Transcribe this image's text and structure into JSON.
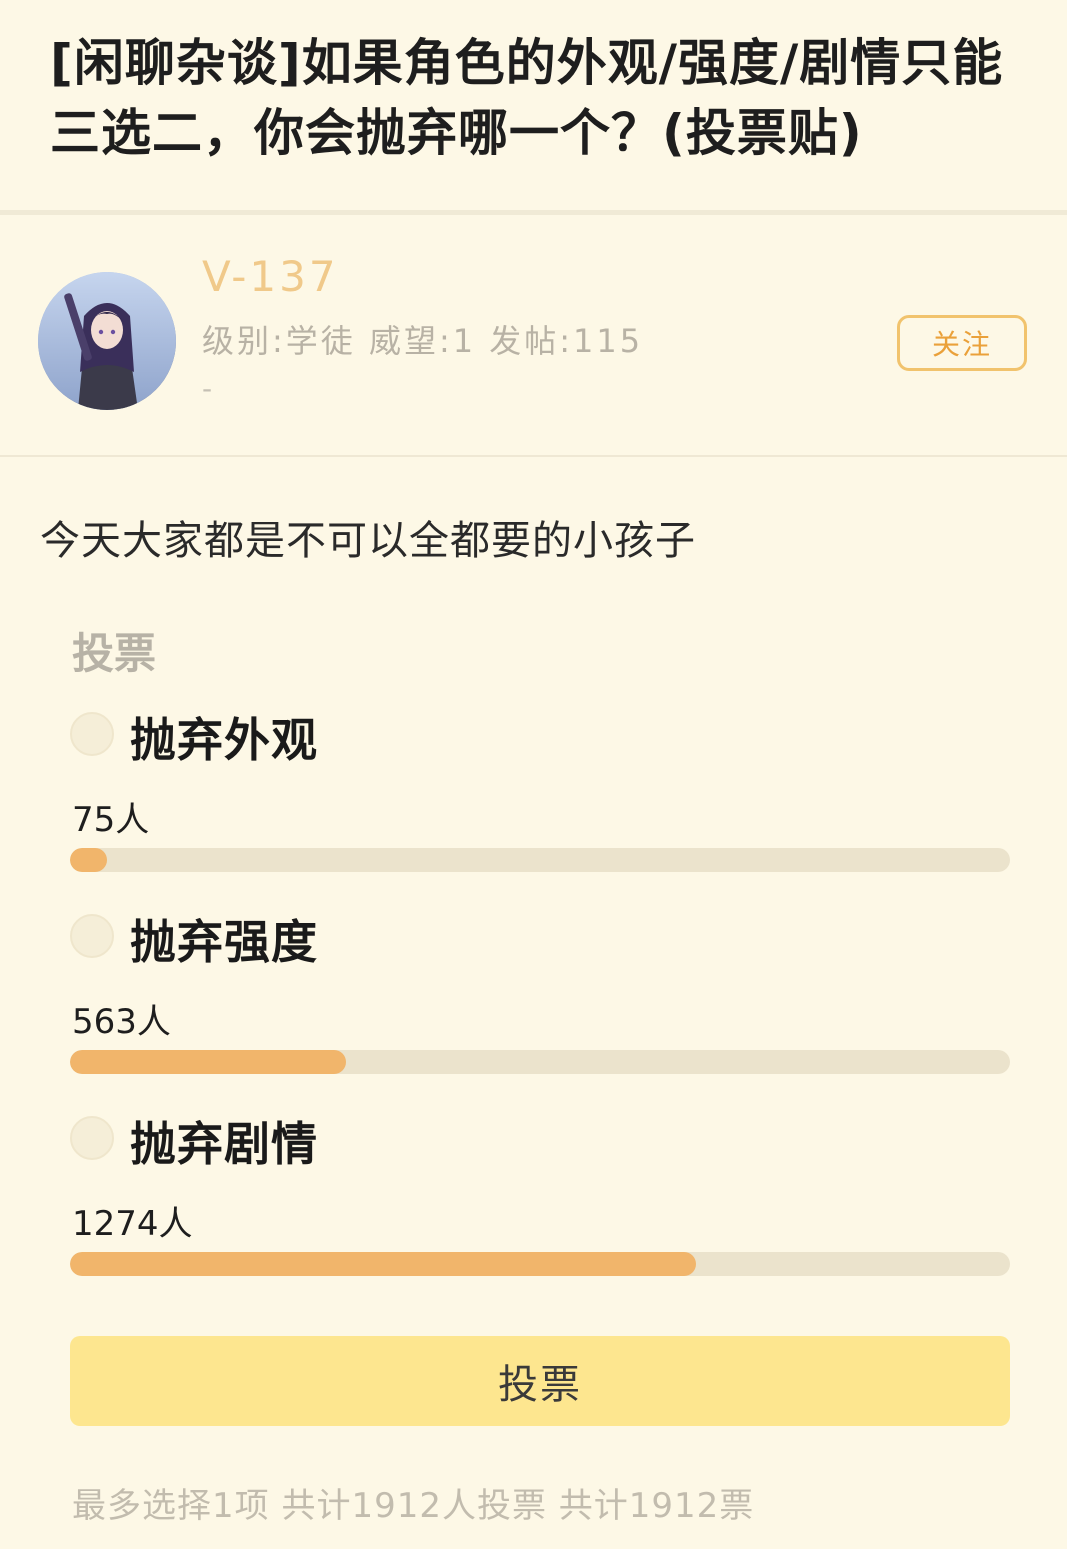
{
  "post": {
    "title": "[闲聊杂谈]如果角色的外观/强度/剧情只能三选二，你会抛弃哪一个？(投票贴)",
    "content": "今天大家都是不可以全都要的小孩子"
  },
  "author": {
    "name": "V-137",
    "stats": "级别:学徒  威望:1  发帖:115",
    "signature": "-",
    "follow_label": "关注"
  },
  "poll": {
    "title": "投票",
    "options": [
      {
        "label": "抛弃外观",
        "count_text": "75人",
        "votes": 75,
        "fraction": 0.039
      },
      {
        "label": "抛弃强度",
        "count_text": "563人",
        "votes": 563,
        "fraction": 0.294
      },
      {
        "label": "抛弃剧情",
        "count_text": "1274人",
        "votes": 1274,
        "fraction": 0.666
      }
    ],
    "vote_button_label": "投票",
    "footer": "最多选择1项 共计1912人投票 共计1912票"
  },
  "colors": {
    "accent": "#f1b56b",
    "username": "#f0c98a",
    "button": "#fde68f",
    "background": "#fdf8e6"
  }
}
